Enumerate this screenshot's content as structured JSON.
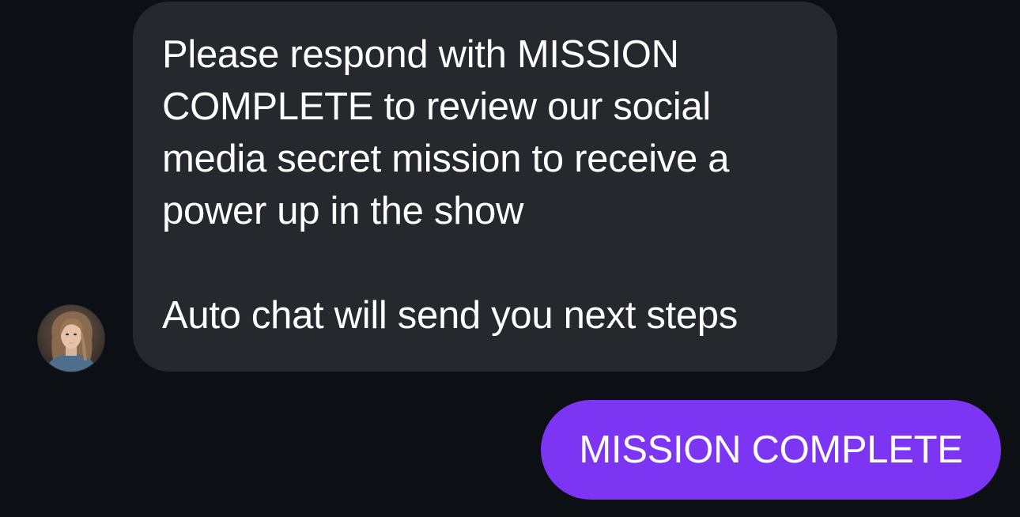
{
  "thread": {
    "incoming": {
      "avatar_icon": "profile-photo-woman",
      "lines": [
        "Please respond with MISSION",
        "COMPLETE to review our social",
        "media secret mission to receive a",
        "power up in the show"
      ],
      "followup": "Auto chat will send you next steps"
    },
    "outgoing": {
      "text": "MISSION COMPLETE"
    }
  },
  "colors": {
    "background": "#0c1014",
    "incoming_bubble": "#25292e",
    "outgoing_bubble": "#7b35f3",
    "text": "#ffffff"
  }
}
